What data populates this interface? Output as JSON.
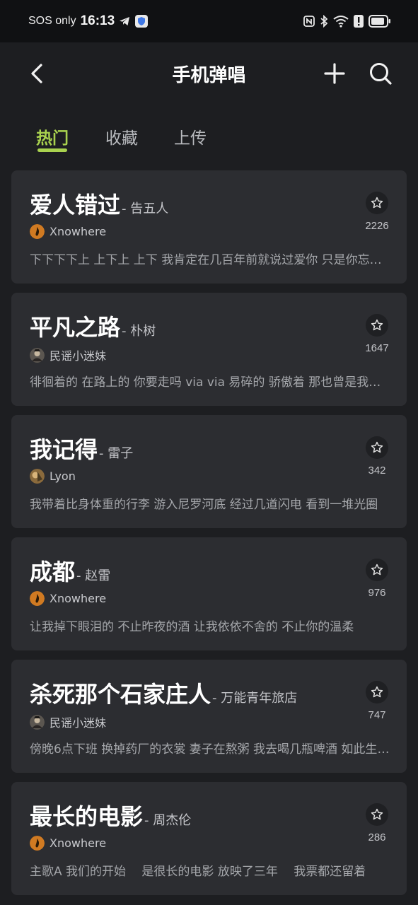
{
  "status_bar": {
    "sos": "SOS only",
    "time": "16:13"
  },
  "header": {
    "title": "手机弹唱",
    "icons": [
      "back-arrow-icon",
      "plus-icon",
      "search-icon"
    ]
  },
  "tabs": [
    {
      "label": "热门",
      "active": true
    },
    {
      "label": "收藏",
      "active": false
    },
    {
      "label": "上传",
      "active": false
    }
  ],
  "colors": {
    "accent": "#a9d24f",
    "card_bg": "#2c2d31",
    "page_bg": "#1d1e21"
  },
  "songs": [
    {
      "title": "爱人错过",
      "artist": "- 告五人",
      "uploader": "Xnowhere",
      "avatar": "flame-avatar",
      "favorites": "2226",
      "lyrics": "下下下下上 上下上 上下 我肯定在几百年前就说过爱你 只是你忘了 我也没记起"
    },
    {
      "title": "平凡之路",
      "artist": "- 朴树",
      "uploader": "民谣小迷妹",
      "avatar": "photo-avatar",
      "favorites": "1647",
      "lyrics": "徘徊着的 在路上的 你要走吗 via via 易碎的 骄傲着 那也曾是我的模样"
    },
    {
      "title": "我记得",
      "artist": "- 雷子",
      "uploader": "Lyon",
      "avatar": "photo-avatar-brown",
      "favorites": "342",
      "lyrics": "我带着比身体重的行李 游入尼罗河底 经过几道闪电 看到一堆光圈"
    },
    {
      "title": "成都",
      "artist": "- 赵雷",
      "uploader": "Xnowhere",
      "avatar": "flame-avatar",
      "favorites": "976",
      "lyrics": "让我掉下眼泪的 不止昨夜的酒 让我依依不舍的 不止你的温柔"
    },
    {
      "title": "杀死那个石家庄人",
      "artist": "- 万能青年旅店",
      "uploader": "民谣小迷妹",
      "avatar": "photo-avatar",
      "favorites": "747",
      "lyrics": "傍晚6点下班 换掉药厂的衣裳 妻子在熬粥 我去喝几瓶啤酒 如此生活三十年"
    },
    {
      "title": "最长的电影",
      "artist": "- 周杰伦",
      "uploader": "Xnowhere",
      "avatar": "flame-avatar",
      "favorites": "286",
      "lyrics": "主歌A 我们的开始　 是很长的电影 放映了三年　 我票都还留着"
    }
  ]
}
